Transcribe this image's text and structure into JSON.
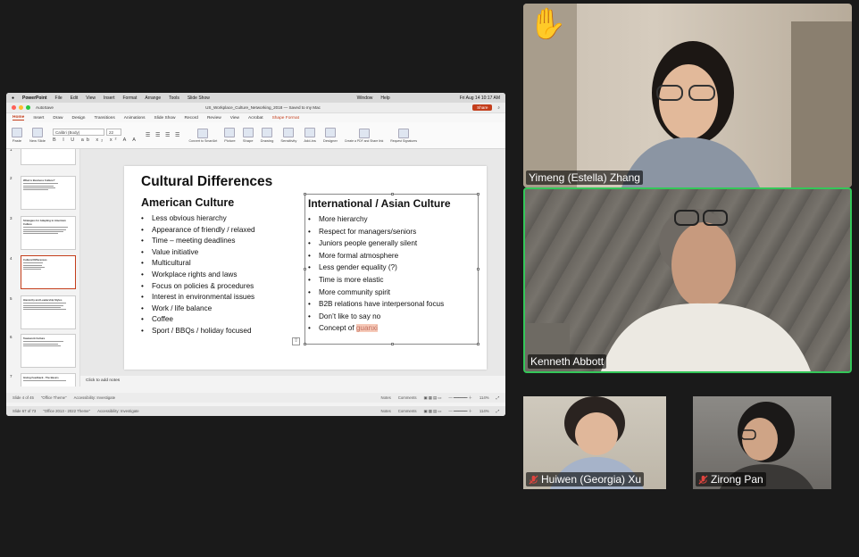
{
  "mac_menubar": {
    "app": "PowerPoint",
    "menus": [
      "File",
      "Edit",
      "View",
      "Insert",
      "Format",
      "Arrange",
      "Tools",
      "Slide Show"
    ],
    "right_menus": [
      "Window",
      "Help"
    ],
    "clock": "Fri Aug 14  10:17 AM"
  },
  "ppt": {
    "autosave": "AutoSave",
    "doc_title": "US_Workplace_Culture_Networking_2018 — Saved to my Mac",
    "share": "Share",
    "tabs": [
      "Home",
      "Insert",
      "Draw",
      "Design",
      "Transitions",
      "Animations",
      "Slide Show",
      "Record",
      "Review",
      "View",
      "Acrobat",
      "Shape Format"
    ],
    "ribbon": {
      "paste": "Paste",
      "new_slide": "New Slide",
      "font": "Calibri (Body)",
      "size": "22",
      "convert": "Convert to SmartArt",
      "picture": "Picture",
      "shape": "Shape",
      "drawing": "Drawing",
      "sensitivity": "Sensitivity",
      "addins": "Add-ins",
      "designer": "Designer",
      "create_pdf": "Create a PDF and Share link",
      "request_sig": "Request Signatures"
    },
    "thumbs": [
      {
        "num": "1",
        "title": ""
      },
      {
        "num": "2",
        "title": "What is Business Culture?"
      },
      {
        "num": "3",
        "title": "Strategies for Adapting to American Culture"
      },
      {
        "num": "4",
        "title": "Cultural Differences"
      },
      {
        "num": "5",
        "title": "Hierarchy and Leadership Styles"
      },
      {
        "num": "6",
        "title": "Teamwork Culture"
      },
      {
        "num": "7",
        "title": "Giving Feedback - The Basics"
      }
    ],
    "slide": {
      "title": "Cultural Differences",
      "left_heading": "American Culture",
      "left_items": [
        "Less obvious hierarchy",
        "Appearance of friendly / relaxed",
        "Time – meeting deadlines",
        "Value initiative",
        "Multicultural",
        "Workplace rights and laws",
        "Focus on policies & procedures",
        "Interest in environmental issues",
        "Work / life balance",
        "Coffee",
        "Sport / BBQs / holiday focused"
      ],
      "right_heading": "International / Asian Culture",
      "right_items": [
        "More hierarchy",
        "Respect for managers/seniors",
        "Juniors people generally silent",
        "More formal atmosphere",
        "Less gender equality (?)",
        "Time is more elastic",
        "More community spirit",
        "B2B relations have interpersonal focus",
        "Don’t like to say no"
      ],
      "last_item_prefix": "Concept of ",
      "last_item_highlight": "guanxi"
    },
    "notes": "Click to add notes",
    "status1": {
      "slide": "Slide 4 of 45",
      "theme": "\"Office Theme\"",
      "accessibility": "Accessibility: Investigate",
      "notes": "Notes",
      "comments": "Comments",
      "zoom": "114%"
    },
    "status2": {
      "slide": "Slide 67 of 73",
      "theme": "\"Office 2013 - 2022 Theme\"",
      "accessibility": "Accessibility: Investigate",
      "notes": "Notes",
      "comments": "Comments",
      "zoom": "114%"
    }
  },
  "participants": [
    {
      "name": "Yimeng (Estella) Zhang",
      "hand_raised": true,
      "muted": false
    },
    {
      "name": "Kenneth Abbott",
      "speaking": true,
      "muted": false
    },
    {
      "name": "Huiwen (Georgia) Xu",
      "muted": true
    },
    {
      "name": "Zirong Pan",
      "muted": true
    }
  ],
  "colors": {
    "speaker_border": "#34c759",
    "accent": "#c43e1c",
    "muted_icon": "#e0443e"
  }
}
